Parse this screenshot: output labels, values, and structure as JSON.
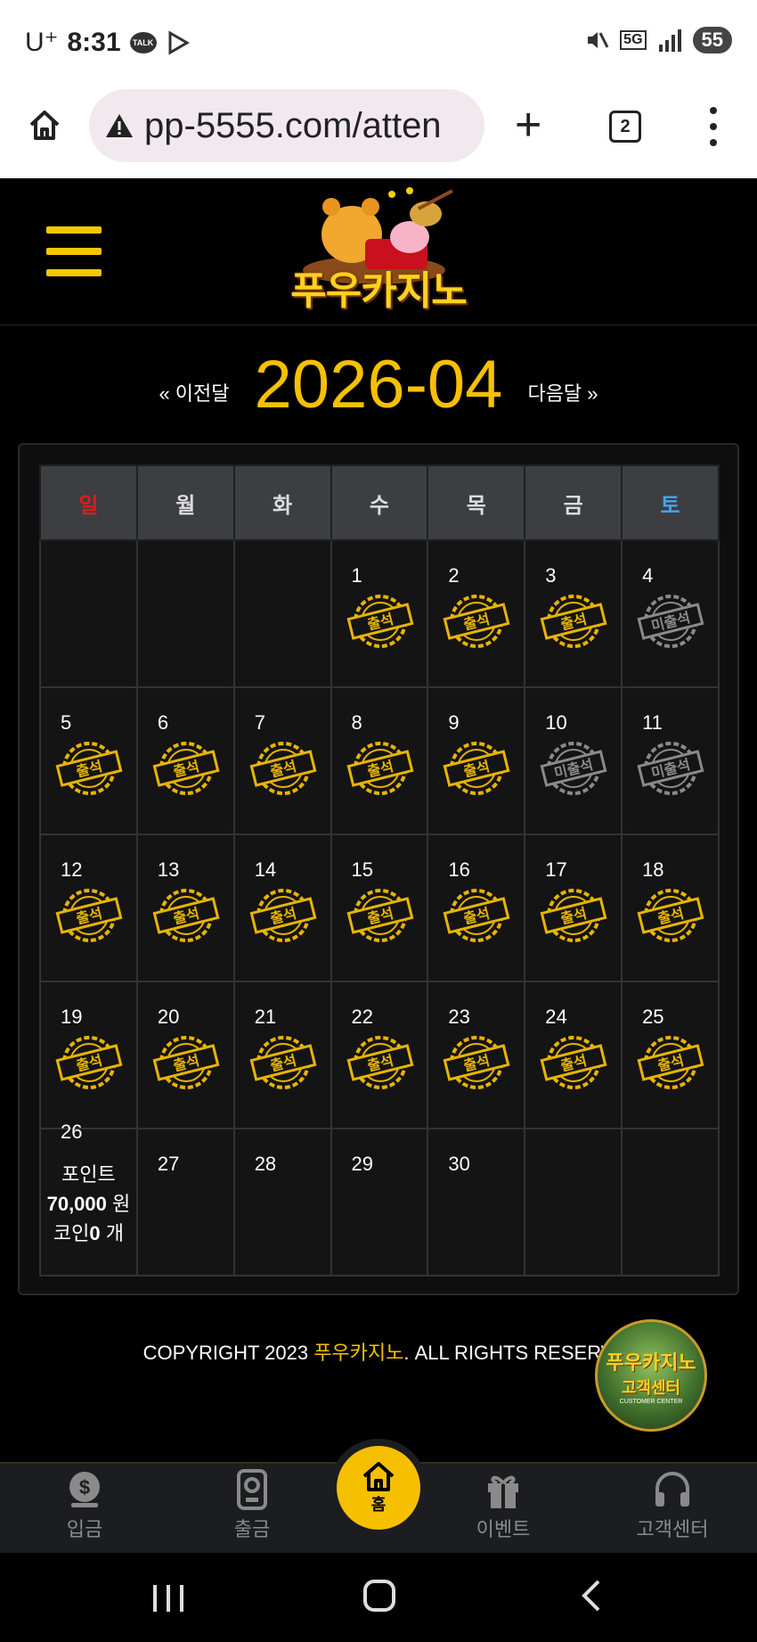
{
  "status": {
    "carrier": "U⁺",
    "time": "8:31",
    "talk": "TALK",
    "network": "5G",
    "battery": "55"
  },
  "browser": {
    "url": "pp-5555.com/atten",
    "tab_count": "2"
  },
  "site": {
    "logo_text": "푸우카지노"
  },
  "month_nav": {
    "prev": "« 이전달",
    "current": "2026-04",
    "next": "다음달 »"
  },
  "calendar": {
    "weekdays": [
      "일",
      "월",
      "화",
      "수",
      "목",
      "금",
      "토"
    ],
    "days": {
      "1": "출석",
      "2": "출석",
      "3": "출석",
      "4": "미출석",
      "5": "출석",
      "6": "출석",
      "7": "출석",
      "8": "출석",
      "9": "출석",
      "10": "미출석",
      "11": "미출석",
      "12": "출석",
      "13": "출석",
      "14": "출석",
      "15": "출석",
      "16": "출석",
      "17": "출석",
      "18": "출석",
      "19": "출석",
      "20": "출석",
      "21": "출석",
      "22": "출석",
      "23": "출석",
      "24": "출석",
      "25": "출석"
    },
    "stamp_attended": "출석",
    "stamp_absent": "미출석",
    "cell26": {
      "day": "26",
      "point_label": "포인트",
      "point_value": "70,000",
      "point_unit": "원",
      "coin_label": "코인",
      "coin_value": "0",
      "coin_unit": "개"
    }
  },
  "footer": {
    "prefix": "COPYRIGHT 2023 ",
    "brand": "푸우카지노",
    "suffix": ". ALL RIGHTS RESERV"
  },
  "cs_badge": {
    "title": "푸우카지노",
    "subtitle": "고객센터",
    "caption": "CUSTOMER CENTER"
  },
  "bottom_nav": {
    "deposit": "입금",
    "withdraw": "출금",
    "home": "홈",
    "event": "이벤트",
    "support": "고객센터"
  },
  "colors": {
    "accent": "#f6c000",
    "sunday": "#e21a1a",
    "saturday": "#47a6ee",
    "stamp_gold": "#e8b400",
    "stamp_gray": "#8a8a8a"
  }
}
